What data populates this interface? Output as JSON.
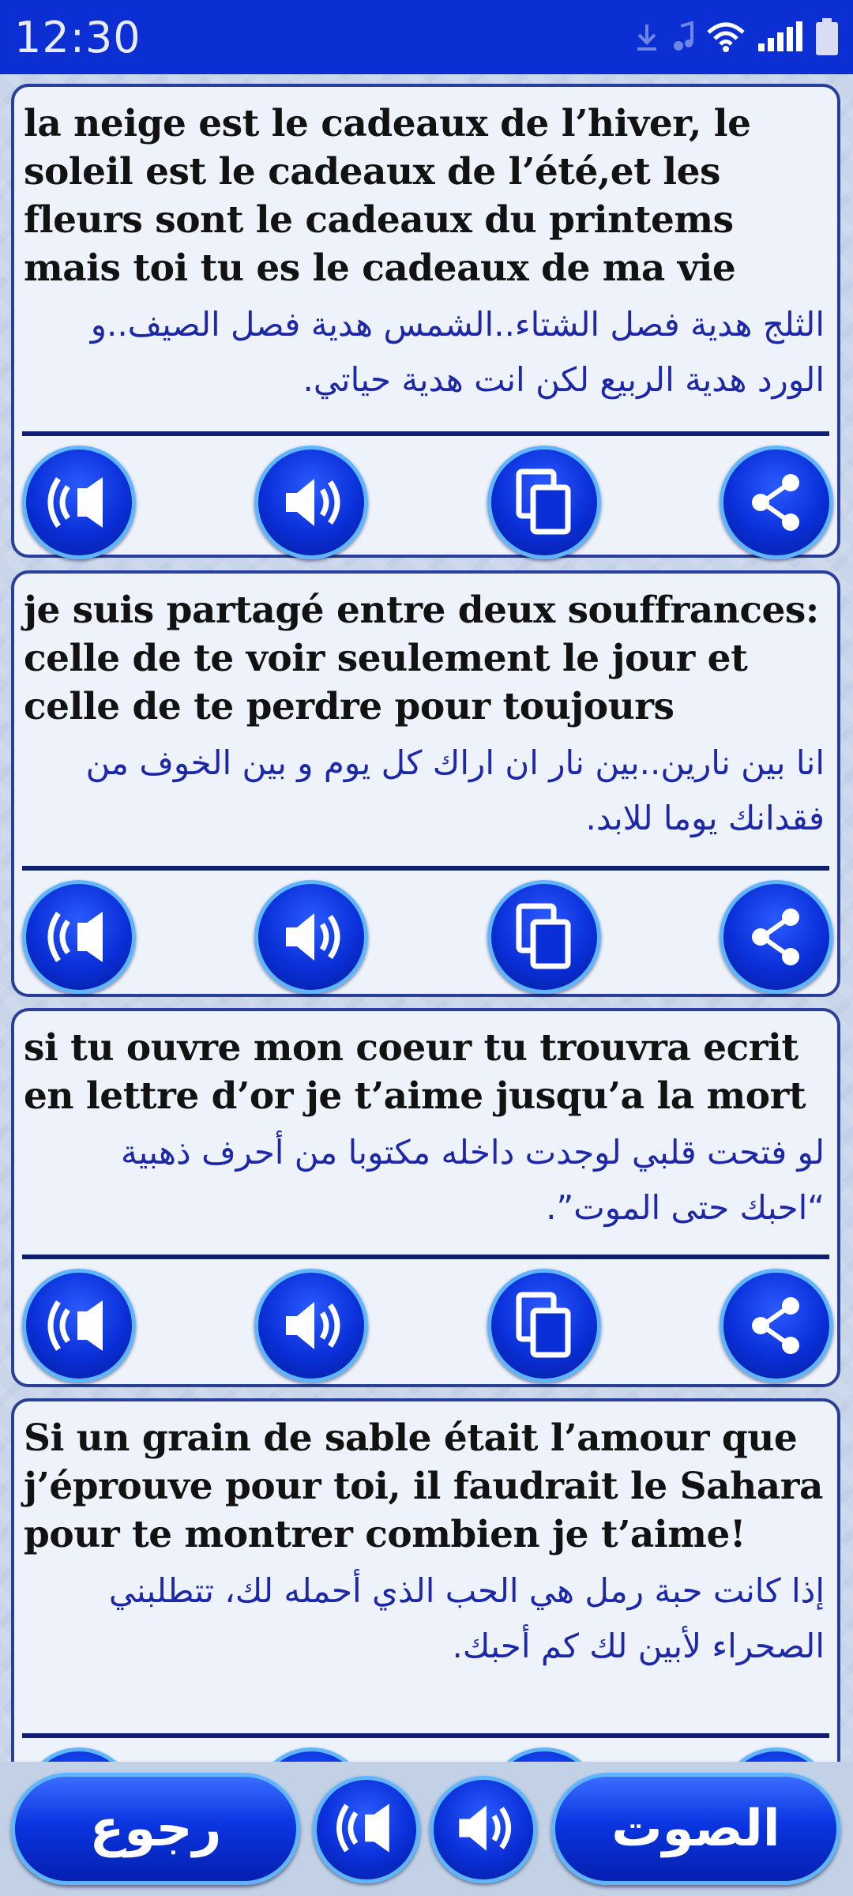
{
  "status_bar": {
    "time": "12:30",
    "icons": [
      "download-icon",
      "music-note-icon",
      "wifi-icon",
      "signal-icon",
      "battery-icon"
    ]
  },
  "cards": [
    {
      "fr": "la neige est le cadeaux de l’hiver, le soleil est le cadeaux de l’été,et les fleurs sont le cadeaux du printems mais toi tu es le cadeaux de ma vie",
      "ar": "الثلج هدية فصل الشتاء..الشمس هدية فصل الصيف..و الورد هدية الربيع لكن انت هدية حياتي."
    },
    {
      "fr": "je suis partagé entre deux souffrances: celle de te voir seulement le jour et celle de te perdre pour toujours",
      "ar": "انا بين نارين..بين نار ان اراك كل يوم و بين الخوف من فقدانك يوما للابد."
    },
    {
      "fr": "si tu ouvre mon coeur tu trouvra ecrit en lettre d’or je t’aime jusqu’a la mort",
      "ar": "لو فتحت قلبي لوجدت داخله مكتوبا من أحرف ذهبية “احبك حتى الموت”."
    },
    {
      "fr": "Si un grain de sable était l’amour que j’éprouve pour toi, il faudrait le Sahara pour te montrer combien je t’aime!",
      "ar": "إذا كانت حبة رمل هي الحب الذي أحمله لك، تتطلبني الصحراء لأبين لك كم أحبك."
    }
  ],
  "card_actions": [
    "speak-french-icon",
    "speak-arabic-icon",
    "copy-icon",
    "share-icon"
  ],
  "bottom_bar": {
    "back_label": "رجوع",
    "sound_label": "الصوت"
  },
  "colors": {
    "status_bar": "#0b2fd3",
    "button_blue": "#0a2fd8",
    "button_ring": "#5fb5ff",
    "card_border": "#2a3f98",
    "arabic_text": "#1d28a8"
  }
}
